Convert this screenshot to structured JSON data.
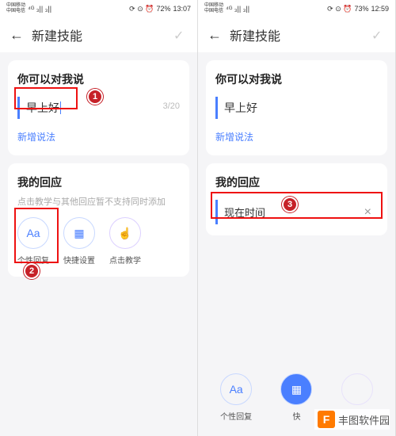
{
  "left": {
    "status": {
      "carrier": "中国移动\n中国电信",
      "signal": "⁴ᴳ ₃|| ₃|| ",
      "icons": "⟳ ⊙ ⏰",
      "battery": "72%",
      "time": "13:07"
    },
    "header": {
      "title": "新建技能"
    },
    "say_card": {
      "title": "你可以对我说",
      "phrase": "早上好",
      "char_count": "3/20",
      "add_phrase": "新增说法"
    },
    "reply_card": {
      "title": "我的回应",
      "subtitle": "点击教学与其他回应暂不支持同时添加",
      "actions": [
        {
          "icon": "Aa",
          "label": "个性回复"
        },
        {
          "icon": "▦",
          "label": "快捷设置"
        },
        {
          "icon": "☝",
          "label": "点击教学"
        }
      ]
    }
  },
  "right": {
    "status": {
      "carrier": "中国移动\n中国电信",
      "signal": "⁴ᴳ ₃|| ₃|| ",
      "icons": "⟳ ⊙ ⏰",
      "battery": "73%",
      "time": "12:59"
    },
    "header": {
      "title": "新建技能"
    },
    "say_card": {
      "title": "你可以对我说",
      "phrase": "早上好",
      "add_phrase": "新增说法"
    },
    "reply_card": {
      "title": "我的回应",
      "reply_text": "现在时间"
    },
    "bottom_actions": [
      {
        "icon": "Aa",
        "label": "个性回复"
      },
      {
        "icon": "▦",
        "label": "快"
      }
    ]
  },
  "callouts": {
    "c1": "1",
    "c2": "2",
    "c3": "3"
  },
  "branding": {
    "text": "丰图软件园"
  }
}
